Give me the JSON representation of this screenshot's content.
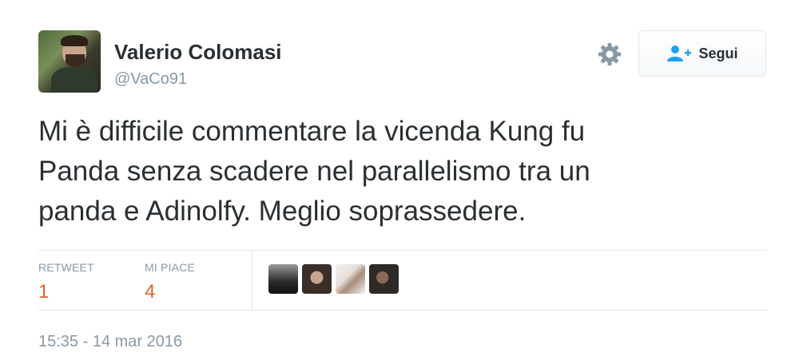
{
  "user": {
    "name": "Valerio Colomasi",
    "handle": "@VaCo91",
    "avatar_icon": "user-avatar"
  },
  "actions": {
    "settings_icon": "gear-icon",
    "follow_label": "Segui",
    "follow_icon": "add-user-icon"
  },
  "tweet": {
    "text_lines": [
      "Mi è difficile commentare la vicenda Kung fu",
      "Panda senza scadere nel parallelismo tra un",
      "panda e Adinolfy. Meglio soprassedere."
    ]
  },
  "stats": {
    "retweet_label": "RETWEET",
    "retweet_count": "1",
    "likes_label": "MI PIACE",
    "likes_count": "4"
  },
  "likers": [
    "liker-avatar-1",
    "liker-avatar-2",
    "liker-avatar-3",
    "liker-avatar-4"
  ],
  "timestamp": "15:35 - 14 mar 2016",
  "colors": {
    "count_accent": "#e0632a",
    "follow_icon": "#1da1f2",
    "muted_text": "#8899a6"
  }
}
